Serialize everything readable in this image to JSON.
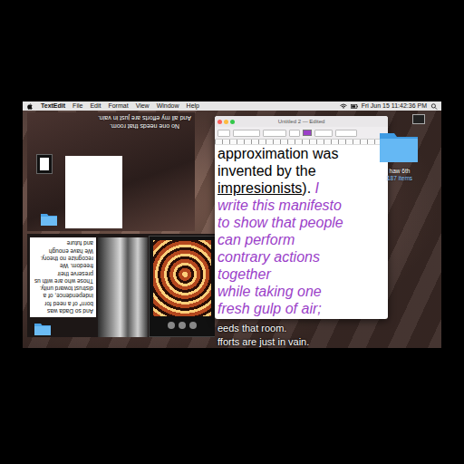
{
  "menubar": {
    "app": "TextEdit",
    "menus": [
      "File",
      "Edit",
      "Format",
      "View",
      "Window",
      "Help"
    ],
    "clock": "Fri Jun 15  11:42:36 PM"
  },
  "recording_window": {
    "subtitles": [
      "No one needs that room.",
      "And all my efforts are just in vain."
    ]
  },
  "nested_recording": {
    "manifesto_lines": [
      "And so Dada was",
      "born* of a need for",
      "independence, of a",
      "distrust toward unity.",
      "Those who are with us",
      "preserve their",
      "freedom. We",
      "recognize no theory.",
      "We have enough",
      "and future"
    ]
  },
  "textedit": {
    "title": "Untitled 2 — Edited",
    "body": [
      {
        "text": "approximation was\ninvented by the\n",
        "kind": "plain"
      },
      {
        "text": "impresionists",
        "kind": "misspelled"
      },
      {
        "text": "). ",
        "kind": "plain"
      },
      {
        "text": "I\nwrite this manifesto\nto show that people\ncan perform\ncontrary actions\ntogether\nwhile taking one\nfresh gulp of air;",
        "kind": "emphasis"
      }
    ]
  },
  "desktop": {
    "folder": {
      "name": "haw 6th",
      "count": "187 items"
    }
  },
  "subtitles": [
    "eeds that room.",
    "fforts are just in vain."
  ]
}
